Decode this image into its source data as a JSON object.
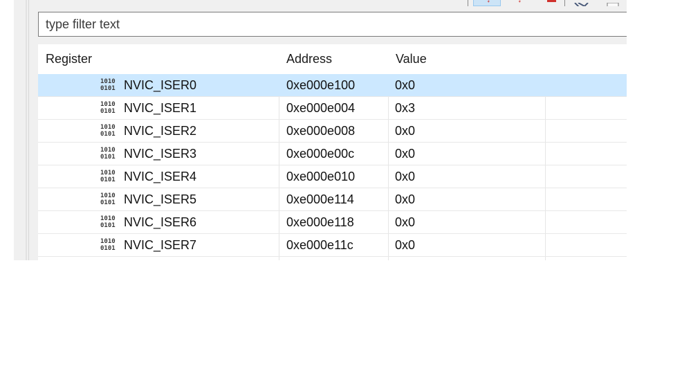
{
  "filter": {
    "placeholder": "type filter text",
    "value": ""
  },
  "table": {
    "columns": [
      "Register",
      "Address",
      "Value"
    ],
    "rows": [
      {
        "register": "NVIC_ISER0",
        "address": "0xe000e100",
        "value": "0x0",
        "selected": true
      },
      {
        "register": "NVIC_ISER1",
        "address": "0xe000e004",
        "value": "0x3"
      },
      {
        "register": "NVIC_ISER2",
        "address": "0xe000e008",
        "value": "0x0"
      },
      {
        "register": "NVIC_ISER3",
        "address": "0xe000e00c",
        "value": "0x0"
      },
      {
        "register": "NVIC_ISER4",
        "address": "0xe000e010",
        "value": "0x0"
      },
      {
        "register": "NVIC_ISER5",
        "address": "0xe000e114",
        "value": "0x0"
      },
      {
        "register": "NVIC_ISER6",
        "address": "0xe000e118",
        "value": "0x0"
      },
      {
        "register": "NVIC_ISER7",
        "address": "0xe000e11c",
        "value": "0x0"
      }
    ],
    "row_icon": "binary-register-icon"
  },
  "colors": {
    "selection": "#cce8ff",
    "toolbar_glyph": "#d0312d"
  }
}
